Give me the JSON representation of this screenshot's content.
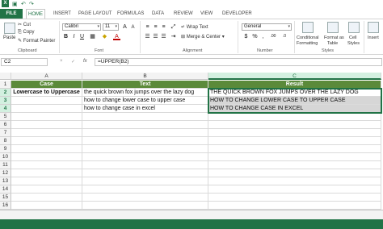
{
  "quick_access": {
    "save_icon": "save-icon",
    "undo_icon": "undo-icon",
    "redo_icon": "redo-icon"
  },
  "tabs": [
    {
      "label": "FILE"
    },
    {
      "label": "HOME"
    },
    {
      "label": "INSERT"
    },
    {
      "label": "PAGE LAYOUT"
    },
    {
      "label": "FORMULAS"
    },
    {
      "label": "DATA"
    },
    {
      "label": "REVIEW"
    },
    {
      "label": "VIEW"
    },
    {
      "label": "DEVELOPER"
    }
  ],
  "ribbon": {
    "clipboard": {
      "paste": "Paste",
      "cut": "Cut",
      "copy": "Copy",
      "format_painter": "Format Painter",
      "label": "Clipboard"
    },
    "font": {
      "name": "Calibri",
      "size": "11",
      "bold": "B",
      "italic": "I",
      "underline": "U",
      "grow": "A",
      "shrink": "A",
      "font_color": "A",
      "label": "Font"
    },
    "alignment": {
      "wrap": "Wrap Text",
      "merge": "Merge & Center",
      "label": "Alignment"
    },
    "number": {
      "format": "General",
      "currency": "$",
      "percent": "%",
      "comma": ",",
      "inc_dec": ".00",
      "dec_dec": ".0",
      "label": "Number"
    },
    "styles": {
      "conditional": "Conditional",
      "formatting": "Formatting",
      "format_as": "Format as",
      "table": "Table",
      "cell": "Cell",
      "cell_styles": "Styles",
      "label": "Styles"
    },
    "insert": "Insert"
  },
  "formula_bar": {
    "namebox": "C2",
    "cancel": "×",
    "enter": "✓",
    "fx": "fx",
    "formula": "=UPPER(B2)"
  },
  "columns": [
    "A",
    "B",
    "C"
  ],
  "rows": [
    "1",
    "2",
    "3",
    "4",
    "5",
    "6",
    "7",
    "8",
    "9",
    "10",
    "11",
    "12",
    "13",
    "14",
    "15",
    "16"
  ],
  "table": {
    "headers": [
      "Case",
      "Text",
      "Result"
    ],
    "row1": [
      "Lowercase to Uppercase",
      "the quick brown fox jumps over the lazy dog",
      "THE QUICK BROWN FOX JUMPS OVER THE LAZY DOG"
    ],
    "row2": [
      "",
      "how to change lower case to upper case",
      "HOW TO CHANGE LOWER CASE TO UPPER CASE"
    ],
    "row3": [
      "",
      "how to change case in excel",
      "HOW TO CHANGE CASE IN EXCEL"
    ]
  },
  "colors": {
    "accent": "#217346",
    "header_fill": "#5b8a3a",
    "selection_fill": "#d6d6d6"
  }
}
